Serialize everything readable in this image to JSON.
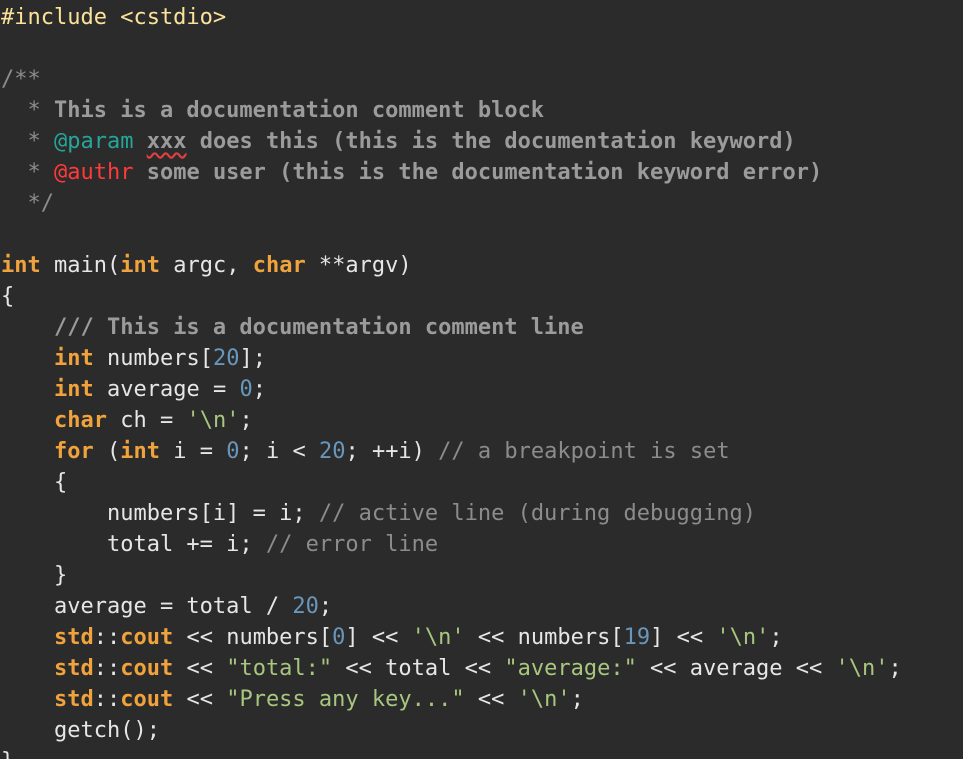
{
  "editor": {
    "lines": [
      [
        {
          "t": "#include <cstdio>",
          "c": "pp"
        }
      ],
      [],
      [
        {
          "t": "/**",
          "c": "cm"
        }
      ],
      [
        {
          "t": "  * ",
          "c": "cm"
        },
        {
          "t": "This is a documentation comment block",
          "c": "doc"
        }
      ],
      [
        {
          "t": "  * ",
          "c": "cm"
        },
        {
          "t": "@param",
          "c": "dockw"
        },
        {
          "t": " ",
          "c": "doc"
        },
        {
          "t": "xxx",
          "c": "doc",
          "err": true
        },
        {
          "t": " does this (this is the documentation keyword)",
          "c": "doc"
        }
      ],
      [
        {
          "t": "  * ",
          "c": "cm"
        },
        {
          "t": "@authr",
          "c": "dockwerr"
        },
        {
          "t": " some user (this is the documentation keyword error)",
          "c": "doc"
        }
      ],
      [
        {
          "t": "  */",
          "c": "cm"
        }
      ],
      [],
      [
        {
          "t": "int",
          "c": "kw"
        },
        {
          "t": " main(",
          "c": "plain"
        },
        {
          "t": "int",
          "c": "kw"
        },
        {
          "t": " argc, ",
          "c": "plain"
        },
        {
          "t": "char",
          "c": "kw"
        },
        {
          "t": " **argv)",
          "c": "plain"
        }
      ],
      [
        {
          "t": "{",
          "c": "plain"
        }
      ],
      [
        {
          "t": "    ",
          "c": "plain"
        },
        {
          "t": "/// This is a documentation comment line",
          "c": "doc"
        }
      ],
      [
        {
          "t": "    ",
          "c": "plain"
        },
        {
          "t": "int",
          "c": "kw"
        },
        {
          "t": " numbers[",
          "c": "plain"
        },
        {
          "t": "20",
          "c": "num"
        },
        {
          "t": "];",
          "c": "plain"
        }
      ],
      [
        {
          "t": "    ",
          "c": "plain"
        },
        {
          "t": "int",
          "c": "kw"
        },
        {
          "t": " average = ",
          "c": "plain"
        },
        {
          "t": "0",
          "c": "num"
        },
        {
          "t": ";",
          "c": "plain"
        }
      ],
      [
        {
          "t": "    ",
          "c": "plain"
        },
        {
          "t": "char",
          "c": "kw"
        },
        {
          "t": " ch = ",
          "c": "plain"
        },
        {
          "t": "'\\n'",
          "c": "str"
        },
        {
          "t": ";",
          "c": "plain"
        }
      ],
      [
        {
          "t": "    ",
          "c": "plain"
        },
        {
          "t": "for",
          "c": "kw"
        },
        {
          "t": " (",
          "c": "plain"
        },
        {
          "t": "int",
          "c": "kw"
        },
        {
          "t": " i = ",
          "c": "plain"
        },
        {
          "t": "0",
          "c": "num"
        },
        {
          "t": "; i < ",
          "c": "plain"
        },
        {
          "t": "20",
          "c": "num"
        },
        {
          "t": "; ++i) ",
          "c": "plain"
        },
        {
          "t": "// a breakpoint is set",
          "c": "cm"
        }
      ],
      [
        {
          "t": "    {",
          "c": "plain"
        }
      ],
      [
        {
          "t": "        numbers[i] = i; ",
          "c": "plain"
        },
        {
          "t": "// active line (during debugging)",
          "c": "cm"
        }
      ],
      [
        {
          "t": "        total += i; ",
          "c": "plain"
        },
        {
          "t": "// error line",
          "c": "cm"
        }
      ],
      [
        {
          "t": "    }",
          "c": "plain"
        }
      ],
      [
        {
          "t": "    average = total / ",
          "c": "plain"
        },
        {
          "t": "20",
          "c": "num"
        },
        {
          "t": ";",
          "c": "plain"
        }
      ],
      [
        {
          "t": "    ",
          "c": "plain"
        },
        {
          "t": "std",
          "c": "kw"
        },
        {
          "t": "::",
          "c": "plain"
        },
        {
          "t": "cout",
          "c": "kw"
        },
        {
          "t": " << numbers[",
          "c": "plain"
        },
        {
          "t": "0",
          "c": "num"
        },
        {
          "t": "] << ",
          "c": "plain"
        },
        {
          "t": "'\\n'",
          "c": "str"
        },
        {
          "t": " << numbers[",
          "c": "plain"
        },
        {
          "t": "19",
          "c": "num"
        },
        {
          "t": "] << ",
          "c": "plain"
        },
        {
          "t": "'\\n'",
          "c": "str"
        },
        {
          "t": ";",
          "c": "plain"
        }
      ],
      [
        {
          "t": "    ",
          "c": "plain"
        },
        {
          "t": "std",
          "c": "kw"
        },
        {
          "t": "::",
          "c": "plain"
        },
        {
          "t": "cout",
          "c": "kw"
        },
        {
          "t": " << ",
          "c": "plain"
        },
        {
          "t": "\"total:\"",
          "c": "str"
        },
        {
          "t": " << total << ",
          "c": "plain"
        },
        {
          "t": "\"average:\"",
          "c": "str"
        },
        {
          "t": " << average << ",
          "c": "plain"
        },
        {
          "t": "'\\n'",
          "c": "str"
        },
        {
          "t": ";",
          "c": "plain"
        }
      ],
      [
        {
          "t": "    ",
          "c": "plain"
        },
        {
          "t": "std",
          "c": "kw"
        },
        {
          "t": "::",
          "c": "plain"
        },
        {
          "t": "cout",
          "c": "kw"
        },
        {
          "t": " << ",
          "c": "plain"
        },
        {
          "t": "\"Press any key...\"",
          "c": "str"
        },
        {
          "t": " << ",
          "c": "plain"
        },
        {
          "t": "'\\n'",
          "c": "str"
        },
        {
          "t": ";",
          "c": "plain"
        }
      ],
      [
        {
          "t": "    getch();",
          "c": "plain"
        }
      ],
      [
        {
          "t": "}",
          "c": "plain"
        }
      ]
    ]
  },
  "colors": {
    "background": "#2b2b2b",
    "plain": "#e6e6e6",
    "preprocessor": "#fbe29b",
    "keyword": "#f0a33c",
    "number": "#6897bb",
    "string": "#a8c77e",
    "comment": "#8c8c8c",
    "doc_comment": "#9b9b9b",
    "doc_keyword": "#26a69a",
    "doc_keyword_error": "#ff3a3a"
  }
}
